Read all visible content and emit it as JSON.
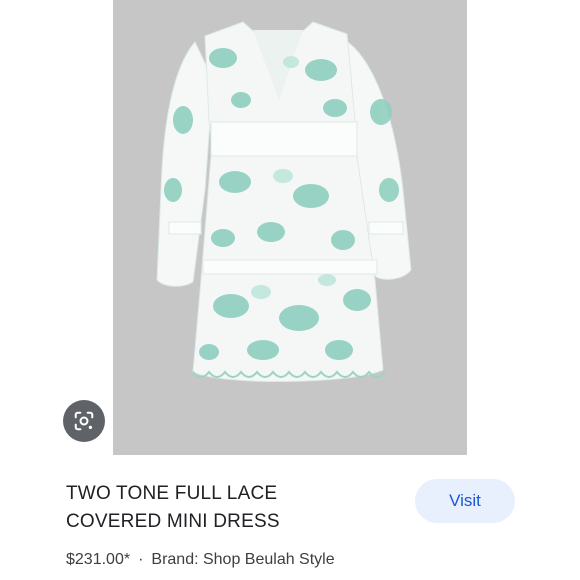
{
  "product": {
    "title_line1": "TWO TONE FULL LACE",
    "title_line2": "COVERED MINI DRESS",
    "price": "$231.00*",
    "separator": "·",
    "brand": "Brand: Shop Beulah Style",
    "visit_label": "Visit"
  },
  "image": {
    "background_color": "#c6c6c6",
    "dress_colors": [
      "#f4f7f6",
      "#8fcfbf",
      "#bfe6dc"
    ]
  },
  "icons": {
    "lens": "google-lens-icon"
  },
  "colors": {
    "visit_bg": "#e8f0fe",
    "visit_text": "#1a57d6",
    "lens_bg": "#5f6368"
  }
}
